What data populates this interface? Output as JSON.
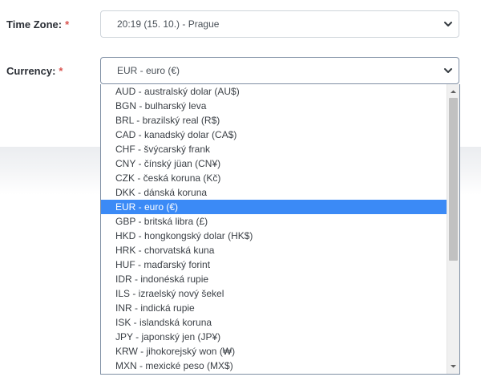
{
  "form": {
    "timezone": {
      "label": "Time Zone:",
      "required_mark": "*",
      "value": "20:19 (15. 10.) - Prague",
      "icon": "chevron-down-icon"
    },
    "currency": {
      "label": "Currency:",
      "required_mark": "*",
      "value": "EUR - euro (€)",
      "icon": "chevron-down-icon"
    }
  },
  "dropdown": {
    "selected_index": 8,
    "scroll_fraction": 0.0,
    "visible_fraction": 0.62,
    "options": [
      "AUD - australský dolar (AU$)",
      "BGN - bulharský leva",
      "BRL - brazilský real (R$)",
      "CAD - kanadský dolar (CA$)",
      "CHF - švýcarský frank",
      "CNY - čínský jüan (CN¥)",
      "CZK - česká koruna (Kč)",
      "DKK - dánská koruna",
      "EUR - euro (€)",
      "GBP - britská libra (£)",
      "HKD - hongkongský dolar (HK$)",
      "HRK - chorvatská kuna",
      "HUF - maďarský forint",
      "IDR - indonéská rupie",
      "ILS - izraelský nový šekel",
      "INR - indická rupie",
      "ISK - islandská koruna",
      "JPY - japonský jen (JP¥)",
      "KRW - jihokorejský won (₩)",
      "MXN - mexické peso (MX$)"
    ]
  },
  "colors": {
    "highlight": "#3b8af6",
    "required": "#d9534f",
    "focus_border": "#7f8fa4"
  }
}
